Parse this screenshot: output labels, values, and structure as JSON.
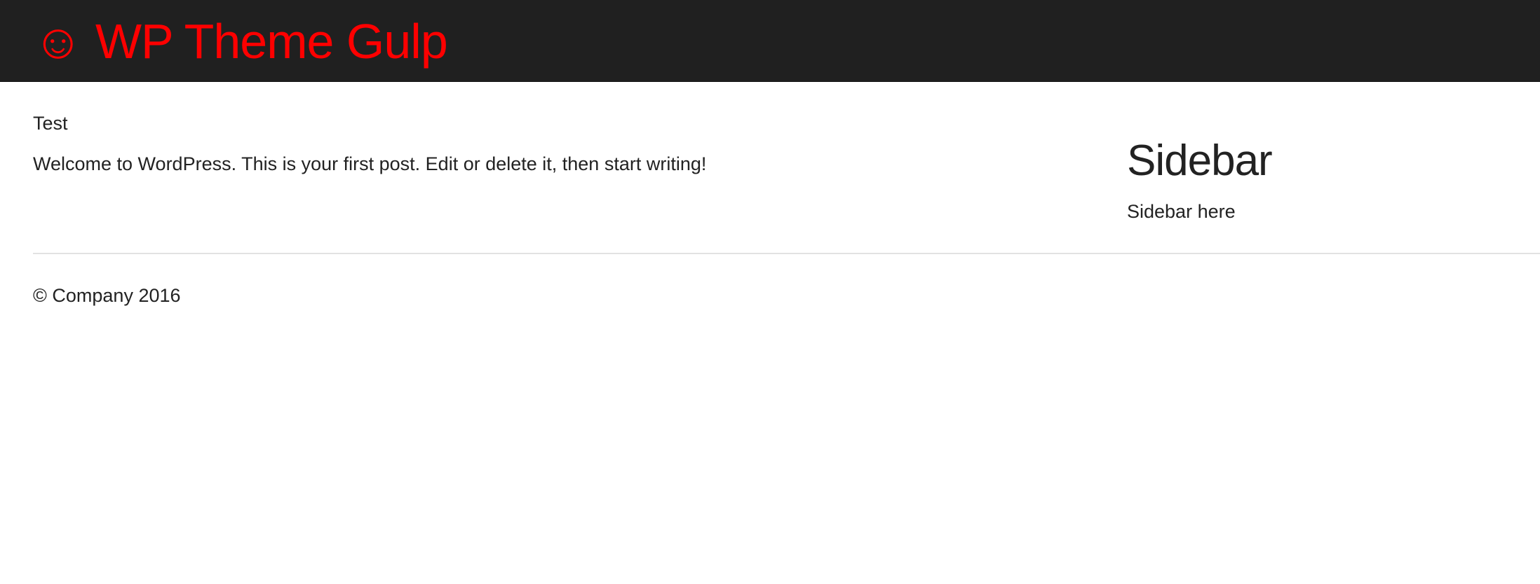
{
  "colors": {
    "header_background": "#202020",
    "site_title": "#ff0000",
    "text": "#222222",
    "divider": "#e2e2e2"
  },
  "header": {
    "icon": "☺",
    "icon_name": "smiley-icon",
    "site_title": "WP Theme Gulp"
  },
  "post": {
    "title": "Test",
    "content": "Welcome to WordPress. This is your first post. Edit or delete it, then start writing!"
  },
  "sidebar": {
    "heading": "Sidebar",
    "text": "Sidebar here"
  },
  "footer": {
    "copyright": "© Company 2016"
  }
}
